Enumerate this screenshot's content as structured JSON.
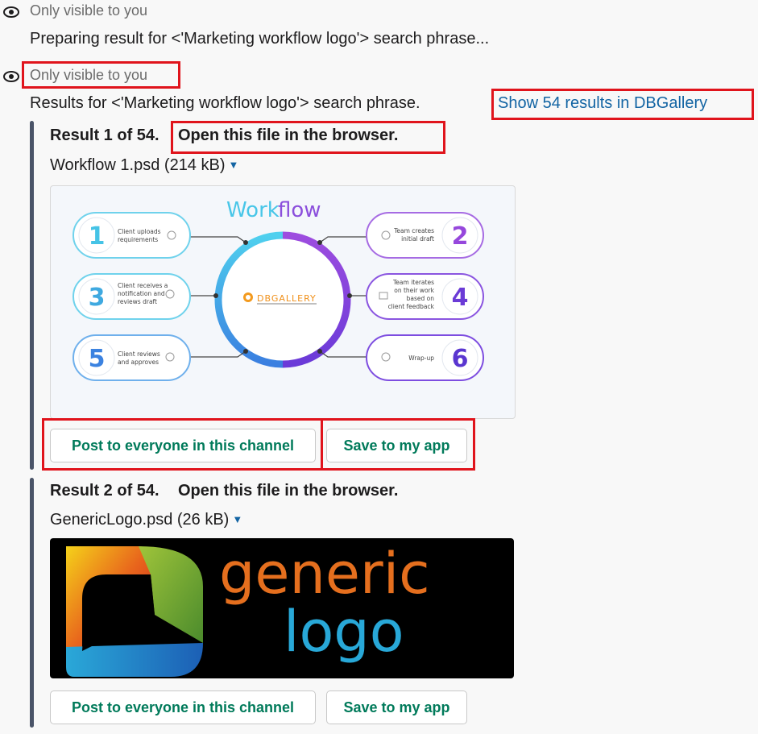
{
  "message1": {
    "visibility": "Only visible to you",
    "text": "Preparing result for <'Marketing workflow logo'> search phrase..."
  },
  "message2": {
    "visibility": "Only visible to you",
    "text": "Results for <'Marketing workflow logo'> search phrase.",
    "show_link": "Show 54 results in DBGallery"
  },
  "results": [
    {
      "title": "Result 1 of 54.",
      "open_link": "Open this file in the browser.",
      "filename": "Workflow 1.psd (214 kB)",
      "post_button": "Post to everyone in this channel",
      "save_button": "Save to my app",
      "image": {
        "heading_a": "Work",
        "heading_b": "flow",
        "center_logo": "DBGALLERY",
        "steps": [
          {
            "num": "1",
            "text1": "Client uploads",
            "text2": "requirements",
            "text3": ""
          },
          {
            "num": "2",
            "text1": "Team creates",
            "text2": "initial draft",
            "text3": ""
          },
          {
            "num": "3",
            "text1": "Client receives a",
            "text2": "notification and",
            "text3": "reviews draft"
          },
          {
            "num": "4",
            "text1": "Team iterates",
            "text2": "on their work",
            "text3": "based on"
          },
          {
            "num": "5",
            "text1": "Client reviews",
            "text2": "and approves",
            "text3": ""
          },
          {
            "num": "6",
            "text1": "Wrap-up",
            "text2": "",
            "text3": ""
          }
        ],
        "step4_extra": "client feedback"
      }
    },
    {
      "title": "Result 2 of 54.",
      "open_link": "Open this file in the browser.",
      "filename": "GenericLogo.psd (26 kB)",
      "post_button": "Post to everyone in this channel",
      "save_button": "Save to my app",
      "image": {
        "word1": "generic",
        "word2": "logo"
      }
    }
  ]
}
